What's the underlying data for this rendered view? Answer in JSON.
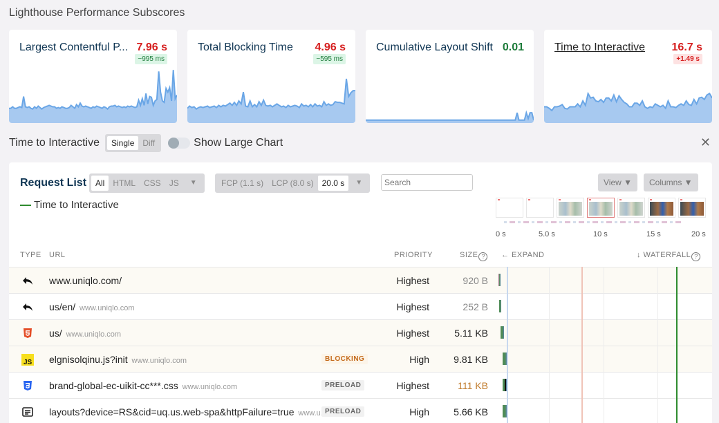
{
  "section_title": "Lighthouse Performance Subscores",
  "cards": [
    {
      "title": "Largest Contentful P...",
      "value": "7.96 s",
      "value_status": "bad",
      "delta": "−995 ms",
      "delta_status": "good",
      "link": false,
      "series": [
        20,
        20,
        22,
        20,
        20,
        21,
        22,
        21,
        36,
        22,
        21,
        22,
        20,
        19,
        22,
        20,
        23,
        21,
        19,
        21,
        22,
        23,
        24,
        23,
        22,
        22,
        20,
        21,
        20,
        22,
        21,
        20,
        20,
        21,
        24,
        22,
        20,
        25,
        22,
        27,
        23,
        22,
        23,
        22,
        21,
        20,
        22,
        21,
        23,
        22,
        21,
        20,
        22,
        21,
        19,
        22,
        23,
        23,
        24,
        22,
        23,
        22,
        21,
        22,
        21,
        23,
        22,
        23,
        22,
        21,
        22,
        31,
        24,
        33,
        24,
        40,
        26,
        36,
        35,
        24,
        30,
        32,
        70,
        42,
        30,
        28,
        47,
        42,
        48,
        30,
        72,
        33,
        38
      ]
    },
    {
      "title": "Total Blocking Time",
      "value": "4.96 s",
      "value_status": "bad",
      "delta": "−595 ms",
      "delta_status": "good",
      "link": false,
      "series": [
        20,
        23,
        21,
        22,
        19,
        21,
        22,
        21,
        22,
        23,
        21,
        22,
        23,
        21,
        24,
        22,
        24,
        23,
        25,
        27,
        24,
        28,
        24,
        30,
        26,
        42,
        23,
        22,
        30,
        22,
        25,
        22,
        29,
        24,
        31,
        24,
        23,
        24,
        22,
        24,
        26,
        24,
        22,
        23,
        21,
        24,
        22,
        23,
        24,
        23,
        21,
        26,
        23,
        24,
        22,
        25,
        22,
        26,
        23,
        24,
        22,
        29,
        24,
        26,
        24,
        25,
        29,
        28,
        28,
        27,
        26,
        60,
        36,
        41,
        44,
        44
      ]
    },
    {
      "title": "Cumulative Layout Shift",
      "value": "0.01",
      "value_status": "good",
      "delta": "",
      "delta_status": "",
      "link": false,
      "series": [
        4,
        4,
        4,
        4,
        4,
        4,
        4,
        4,
        4,
        4,
        4,
        4,
        4,
        4,
        4,
        4,
        4,
        4,
        4,
        4,
        4,
        4,
        4,
        4,
        4,
        4,
        4,
        4,
        4,
        4,
        4,
        4,
        4,
        4,
        4,
        4,
        4,
        4,
        4,
        4,
        4,
        4,
        4,
        4,
        4,
        4,
        4,
        4,
        4,
        4,
        4,
        4,
        4,
        4,
        4,
        4,
        4,
        4,
        4,
        4,
        4,
        4,
        4,
        4,
        4,
        4,
        4,
        4,
        4,
        4,
        4,
        4,
        4,
        4,
        4,
        4,
        4,
        4,
        4,
        4,
        4,
        4,
        14,
        4,
        4,
        4,
        4,
        14,
        6,
        14,
        14,
        4
      ]
    },
    {
      "title": "Time to Interactive",
      "value": "16.7 s",
      "value_status": "bad",
      "delta": "+1.49 s",
      "delta_status": "bad",
      "link": true,
      "series": [
        22,
        22,
        20,
        17,
        22,
        22,
        23,
        25,
        20,
        19,
        22,
        22,
        22,
        26,
        22,
        30,
        24,
        40,
        34,
        35,
        30,
        29,
        32,
        28,
        34,
        34,
        30,
        38,
        29,
        37,
        32,
        28,
        26,
        22,
        22,
        27,
        27,
        24,
        30,
        22,
        20,
        22,
        21,
        26,
        24,
        22,
        24,
        20,
        30,
        22,
        22,
        21,
        24,
        26,
        24,
        30,
        25,
        24,
        32,
        26,
        34,
        35,
        32,
        38,
        40,
        34
      ]
    }
  ],
  "chart_controls": {
    "metric_label": "Time to Interactive",
    "mode_options": [
      "Single",
      "Diff"
    ],
    "mode_selected": "Single",
    "large_chart_label": "Show Large Chart",
    "large_chart_on": false
  },
  "request_list": {
    "title": "Request List",
    "type_filters": [
      "All",
      "HTML",
      "CSS",
      "JS"
    ],
    "type_selected": "All",
    "time_filters": [
      "FCP (1.1 s)",
      "LCP (8.0 s)",
      "20.0 s"
    ],
    "time_selected": "20.0 s",
    "search_placeholder": "Search",
    "view_label": "View ▼",
    "columns_label": "Columns ▼",
    "legend_label": "Time to Interactive",
    "filmstrip_ticks": [
      "0 s",
      "5.0 s",
      "10 s",
      "15 s",
      "20 s"
    ],
    "filmstrip_frames": [
      "blank",
      "blank-header",
      "models",
      "models-selected",
      "models",
      "brick",
      "brick"
    ],
    "headers": {
      "type": "TYPE",
      "url": "URL",
      "priority": "PRIORITY",
      "size": "SIZE",
      "expand": "← EXPAND",
      "waterfall": "↓ WATERFALL"
    },
    "rows": [
      {
        "type": "redirect",
        "url": "www.uniqlo.com/",
        "host": "",
        "badge": "",
        "priority": "Highest",
        "size": "920 B",
        "size_style": "muted",
        "start": 0.0
      },
      {
        "type": "redirect",
        "url": "us/en/",
        "host": "www.uniqlo.com",
        "badge": "",
        "priority": "Highest",
        "size": "252 B",
        "size_style": "muted",
        "start": 0.1
      },
      {
        "type": "html",
        "url": "us/",
        "host": "www.uniqlo.com",
        "badge": "",
        "priority": "Highest",
        "size": "5.11 KB",
        "size_style": "",
        "start": 0.25
      },
      {
        "type": "js",
        "url": "elgnisolqinu.js?init",
        "host": "www.uniqlo.com",
        "badge": "BLOCKING",
        "priority": "High",
        "size": "9.81 KB",
        "size_style": "",
        "start": 0.4
      },
      {
        "type": "css",
        "url": "brand-global-ec-uikit-cc***.css",
        "host": "www.uniqlo.com",
        "badge": "PRELOAD",
        "priority": "Highest",
        "size": "111 KB",
        "size_style": "warn",
        "start": 0.4
      },
      {
        "type": "doc",
        "url": "layouts?device=RS&cid=uq.us.web-spa&httpFailure=true",
        "host": "www.u...",
        "badge": "PRELOAD",
        "priority": "High",
        "size": "5.66 KB",
        "size_style": "",
        "start": 0.4
      }
    ]
  },
  "colors": {
    "sparkline_fill": "#a7c9f0",
    "sparkline_line": "#6aa6e6",
    "tti_line": "#2e8b2e",
    "lcp_line": "#f0c4b8",
    "fcp_line": "#c7d8ef"
  }
}
